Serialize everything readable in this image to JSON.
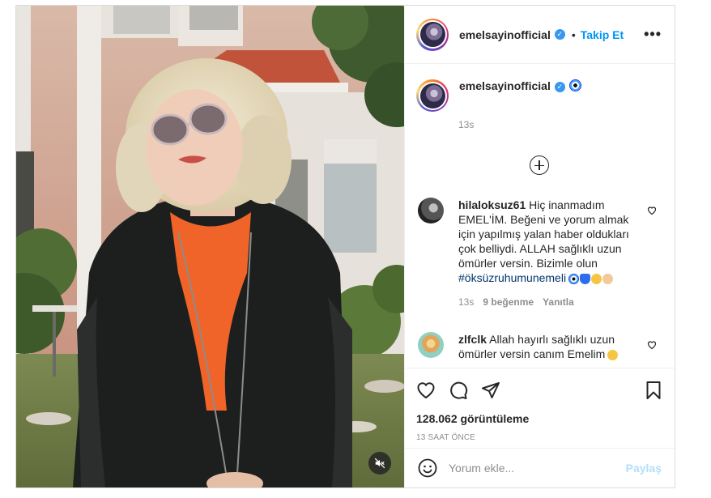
{
  "header": {
    "username": "emelsayinofficial",
    "separator": "•",
    "follow_label": "Takip Et",
    "more_label": "•••"
  },
  "caption": {
    "username": "emelsayinofficial",
    "time": "13s"
  },
  "comments": [
    {
      "username": "hilaloksuz61",
      "text": "Hiç inanmadım EMEL'İM. Beğeni ve yorum almak için yapılmış yalan haber oldukları çok belliydi. ALLAH sağlıklı uzun ömürler versin. Bizimle olun",
      "hashtag": "#öksüzruhumunemeli",
      "time": "13s",
      "likes": "9 beğenme",
      "reply_label": "Yanıtla"
    },
    {
      "username": "zlfclk",
      "text": "Allah hayırlı sağlıklı uzun ömürler versin canım Emelim"
    }
  ],
  "stats": {
    "views": "128.062 görüntüleme",
    "ago": "13 SAAT ÖNCE"
  },
  "add_comment": {
    "placeholder": "Yorum ekle...",
    "post_label": "Paylaş"
  },
  "colors": {
    "accent": "#0095f6",
    "verified": "#3897f0",
    "muted": "#8e8e8e",
    "post_disabled": "#b2dffc",
    "border": "#dbdbdb"
  },
  "icons": [
    "verified-badge-icon",
    "more-options-icon",
    "evil-eye-emoji-icon",
    "load-more-plus-icon",
    "like-heart-icon",
    "comment-icon",
    "share-icon",
    "bookmark-icon",
    "emoji-icon",
    "mute-icon"
  ]
}
